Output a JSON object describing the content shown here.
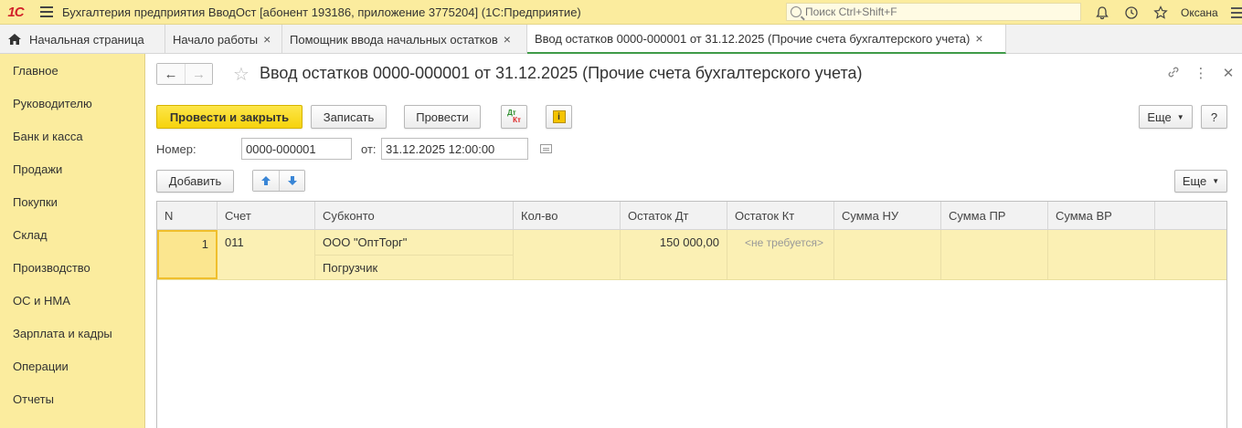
{
  "titlebar": {
    "logo": "1С",
    "title": "Бухгалтерия предприятия ВводОст [абонент 193186, приложение 3775204]  (1С:Предприятие)",
    "search_placeholder": "Поиск Ctrl+Shift+F",
    "user": "Оксана"
  },
  "tabs": [
    {
      "label": "Начальная страница"
    },
    {
      "label": "Начало работы"
    },
    {
      "label": "Помощник ввода начальных остатков"
    },
    {
      "label": "Ввод остатков 0000-000001 от 31.12.2025 (Прочие счета бухгалтерского учета)"
    }
  ],
  "sidebar": {
    "items": [
      {
        "label": "Главное"
      },
      {
        "label": "Руководителю"
      },
      {
        "label": "Банк и касса"
      },
      {
        "label": "Продажи"
      },
      {
        "label": "Покупки"
      },
      {
        "label": "Склад"
      },
      {
        "label": "Производство"
      },
      {
        "label": "ОС и НМА"
      },
      {
        "label": "Зарплата и кадры"
      },
      {
        "label": "Операции"
      },
      {
        "label": "Отчеты"
      }
    ]
  },
  "document": {
    "title": "Ввод остатков 0000-000001 от 31.12.2025 (Прочие счета бухгалтерского учета)",
    "toolbar": {
      "post_close": "Провести и закрыть",
      "save": "Записать",
      "post": "Провести",
      "dt": "Дт",
      "kt": "Кт",
      "info": "i",
      "more": "Еще",
      "help": "?"
    },
    "number_label": "Номер:",
    "number_value": "0000-000001",
    "date_label": "от:",
    "date_value": "31.12.2025 12:00:00",
    "table_toolbar": {
      "add": "Добавить",
      "more": "Еще"
    },
    "table": {
      "columns": [
        "N",
        "Счет",
        "Субконто",
        "Кол-во",
        "Остаток Дт",
        "Остаток Кт",
        "Сумма НУ",
        "Сумма ПР",
        "Сумма ВР"
      ],
      "rows": [
        {
          "n": "1",
          "account": "011",
          "subconto1": "ООО \"ОптТорг\"",
          "subconto2": "Погрузчик",
          "qty": "",
          "balance_dt": "150 000,00",
          "balance_kt": "<не требуется>",
          "sum_nu": "",
          "sum_pr": "",
          "sum_vr": ""
        }
      ]
    }
  }
}
